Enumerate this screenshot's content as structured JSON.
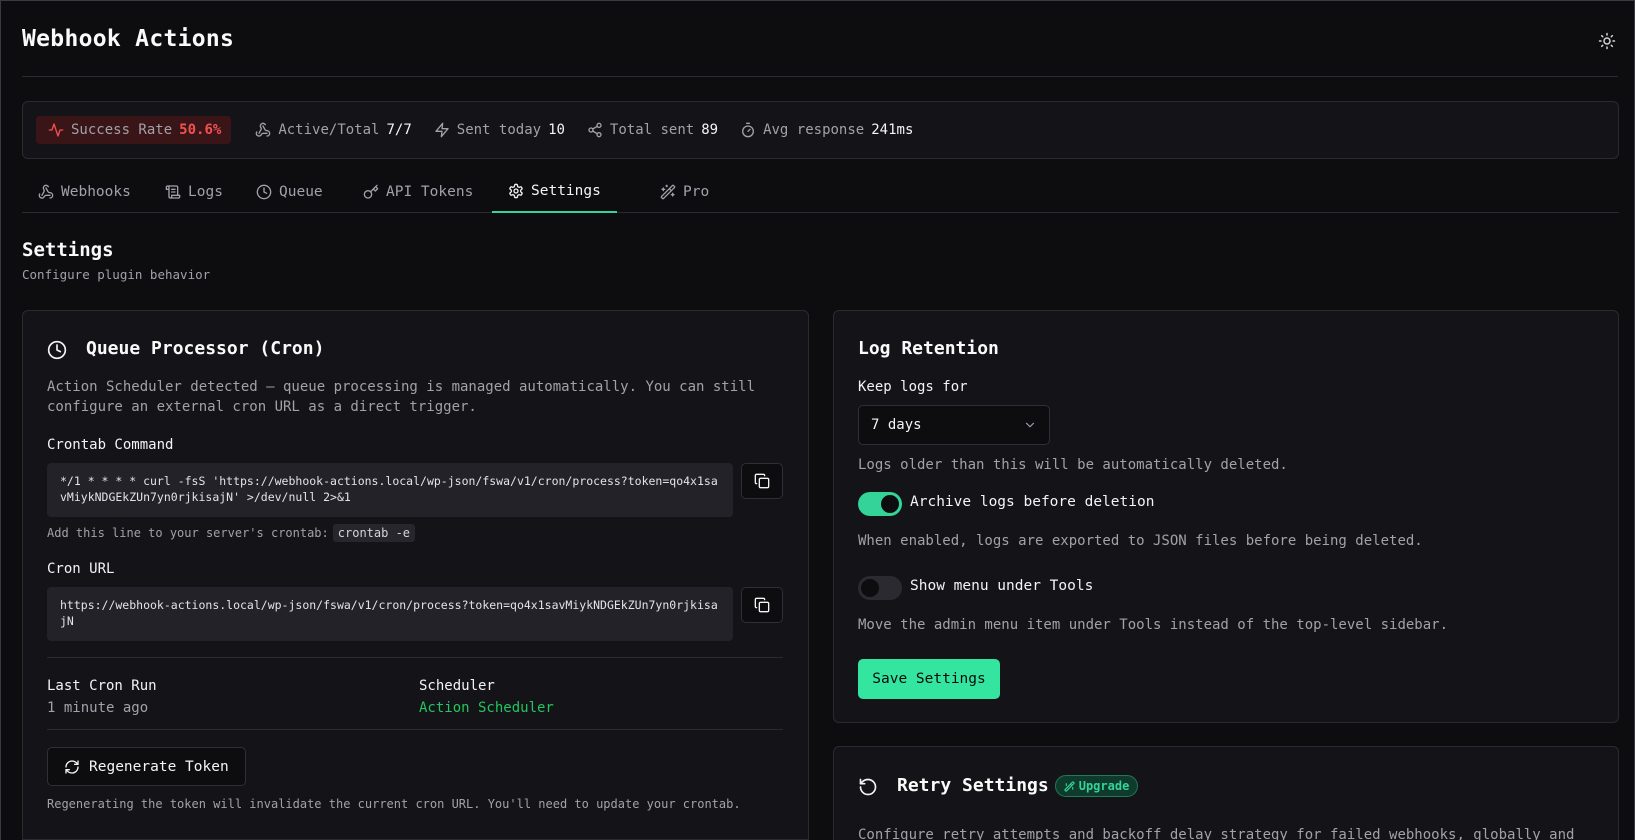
{
  "app": {
    "title": "Webhook Actions"
  },
  "stats": {
    "success_rate_label": "Success Rate",
    "success_rate_value": "50.6%",
    "active_label": "Active/Total",
    "active_value": "7/7",
    "sent_today_label": "Sent today",
    "sent_today_value": "10",
    "total_sent_label": "Total sent",
    "total_sent_value": "89",
    "avg_response_label": "Avg response",
    "avg_response_value": "241ms"
  },
  "tabs": [
    {
      "label": "Webhooks",
      "icon": "webhook-icon"
    },
    {
      "label": "Logs",
      "icon": "scroll-icon"
    },
    {
      "label": "Queue",
      "icon": "clock-icon"
    },
    {
      "label": "API Tokens",
      "icon": "key-icon"
    },
    {
      "label": "Settings",
      "icon": "gear-icon",
      "active": true
    },
    {
      "label": "Pro",
      "icon": "sparkles-icon"
    }
  ],
  "page": {
    "title": "Settings",
    "subtitle": "Configure plugin behavior"
  },
  "queue": {
    "title": "Queue Processor (Cron)",
    "description": "Action Scheduler detected — queue processing is managed automatically. You can still configure an external cron URL as a direct trigger.",
    "crontab_label": "Crontab Command",
    "crontab_value": "*/1 * * * * curl -fsS 'https://webhook-actions.local/wp-json/fswa/v1/cron/process?token=qo4x1savMiykNDGEkZUn7yn0rjkisajN' >/dev/null 2>&1",
    "crontab_hint": "Add this line to your server's crontab:",
    "crontab_hint_code": "crontab -e",
    "cron_url_label": "Cron URL",
    "cron_url_value": "https://webhook-actions.local/wp-json/fswa/v1/cron/process?token=qo4x1savMiykNDGEkZUn7yn0rjkisajN",
    "last_run_label": "Last Cron Run",
    "last_run_value": "1 minute ago",
    "scheduler_label": "Scheduler",
    "scheduler_value": "Action Scheduler",
    "regenerate_label": "Regenerate Token",
    "regenerate_hint": "Regenerating the token will invalidate the current cron URL. You'll need to update your crontab."
  },
  "log_retention": {
    "title": "Log Retention",
    "keep_label": "Keep logs for",
    "keep_value": "7 days",
    "keep_hint": "Logs older than this will be automatically deleted.",
    "archive_label": "Archive logs before deletion",
    "archive_enabled": true,
    "archive_hint": "When enabled, logs are exported to JSON files before being deleted.",
    "menu_label": "Show menu under Tools",
    "menu_enabled": false,
    "menu_hint": "Move the admin menu item under Tools instead of the top-level sidebar.",
    "save_label": "Save Settings"
  },
  "retry": {
    "title": "Retry Settings",
    "badge": "Upgrade",
    "description": "Configure retry attempts and backoff delay strategy for failed webhooks, globally and"
  },
  "colors": {
    "accent": "#34d399",
    "danger": "#f05252",
    "background": "#0d0d0f",
    "card": "#141418"
  }
}
